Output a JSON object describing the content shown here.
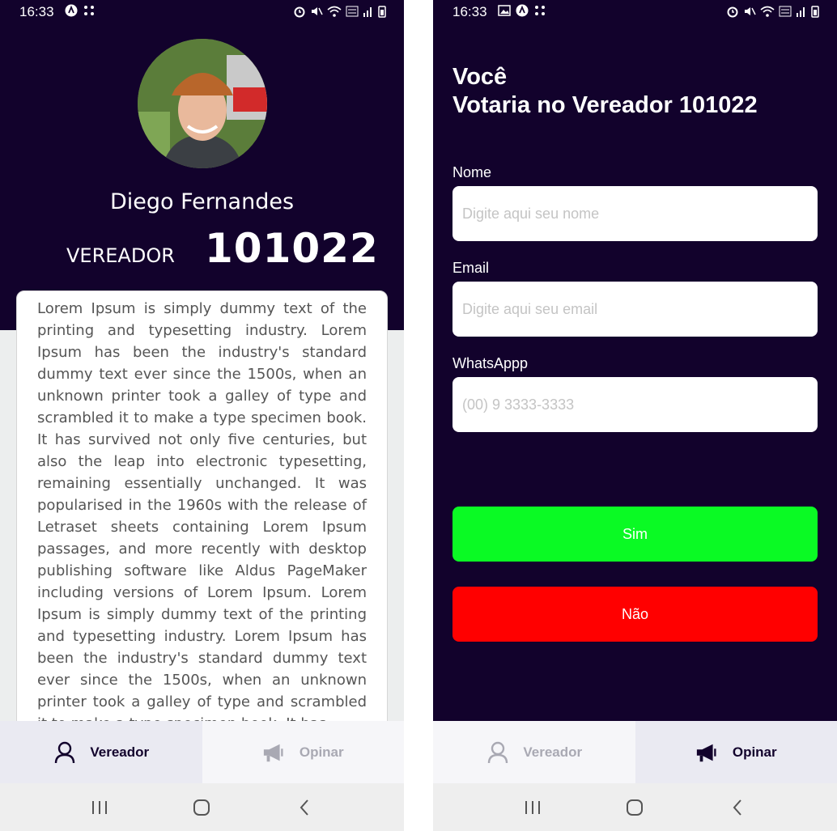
{
  "colors": {
    "primary_dark": "#12022c",
    "yes_green": "#0afa24",
    "no_red": "#ff0000",
    "inactive_tab_text": "#a9a9b3"
  },
  "left_screen": {
    "status_bar": {
      "time": "16:33"
    },
    "profile": {
      "name": "Diego Fernandes",
      "role": "VEREADOR",
      "number": "101022"
    },
    "bio": "Lorem Ipsum is simply dummy text of the printing and typesetting industry. Lorem Ipsum has been the industry's standard dummy text ever since the 1500s, when an unknown printer took a galley of type and scrambled it to make a type specimen book. It has survived not only five centuries, but also the leap into electronic typesetting, remaining essentially unchanged. It was popularised in the 1960s with the release of Letraset sheets containing Lorem Ipsum passages, and more recently with desktop publishing software like Aldus PageMaker including versions of Lorem Ipsum. Lorem Ipsum is simply dummy text of the printing and typesetting industry. Lorem Ipsum has been the industry's standard dummy text ever since the 1500s, when an unknown printer took a galley of type and scrambled it to make a type specimen book. It has",
    "tabs": [
      {
        "label": "Vereador",
        "icon": "person-icon",
        "active": true
      },
      {
        "label": "Opinar",
        "icon": "megaphone-icon",
        "active": false
      }
    ]
  },
  "right_screen": {
    "status_bar": {
      "time": "16:33"
    },
    "title_line1": "Você",
    "title_line2": "Votaria no Vereador 101022",
    "fields": [
      {
        "label": "Nome",
        "placeholder": "Digite aqui seu nome",
        "value": ""
      },
      {
        "label": "Email",
        "placeholder": "Digite aqui seu email",
        "value": ""
      },
      {
        "label": "WhatsAppp",
        "placeholder": "(00) 9 3333-3333",
        "value": ""
      }
    ],
    "buttons": {
      "yes_label": "Sim",
      "no_label": "Não"
    },
    "tabs": [
      {
        "label": "Vereador",
        "icon": "person-icon",
        "active": false
      },
      {
        "label": "Opinar",
        "icon": "megaphone-icon",
        "active": true
      }
    ]
  }
}
